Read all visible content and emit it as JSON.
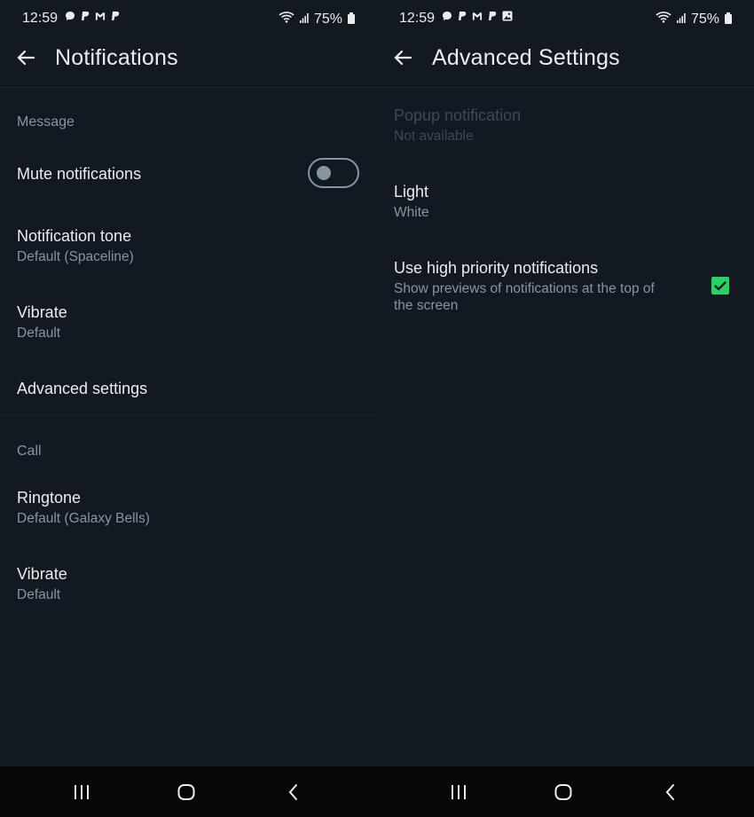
{
  "status": {
    "time": "12:59",
    "battery": "75%"
  },
  "left": {
    "title": "Notifications",
    "sections": {
      "message": "Message",
      "call": "Call"
    },
    "items": {
      "mute": {
        "title": "Mute notifications"
      },
      "tone": {
        "title": "Notification tone",
        "subtitle": "Default (Spaceline)"
      },
      "vibrate": {
        "title": "Vibrate",
        "subtitle": "Default"
      },
      "advanced": {
        "title": "Advanced settings"
      },
      "ringtone": {
        "title": "Ringtone",
        "subtitle": "Default (Galaxy Bells)"
      },
      "call_vibrate": {
        "title": "Vibrate",
        "subtitle": "Default"
      }
    }
  },
  "right": {
    "title": "Advanced Settings",
    "items": {
      "popup": {
        "title": "Popup notification",
        "subtitle": "Not available"
      },
      "light": {
        "title": "Light",
        "subtitle": "White"
      },
      "priority": {
        "title": "Use high priority notifications",
        "subtitle_line1": "Show previews of notifications at the top of",
        "subtitle_line2": "the screen"
      }
    }
  },
  "colors": {
    "background": "#121920",
    "accent": "#25d366",
    "secondary_text": "#8696a0"
  },
  "icons": [
    "back-arrow-icon",
    "wifi-icon",
    "signal-icon",
    "battery-icon",
    "checkbox-checked-icon",
    "recents-icon",
    "home-icon",
    "back-icon"
  ]
}
